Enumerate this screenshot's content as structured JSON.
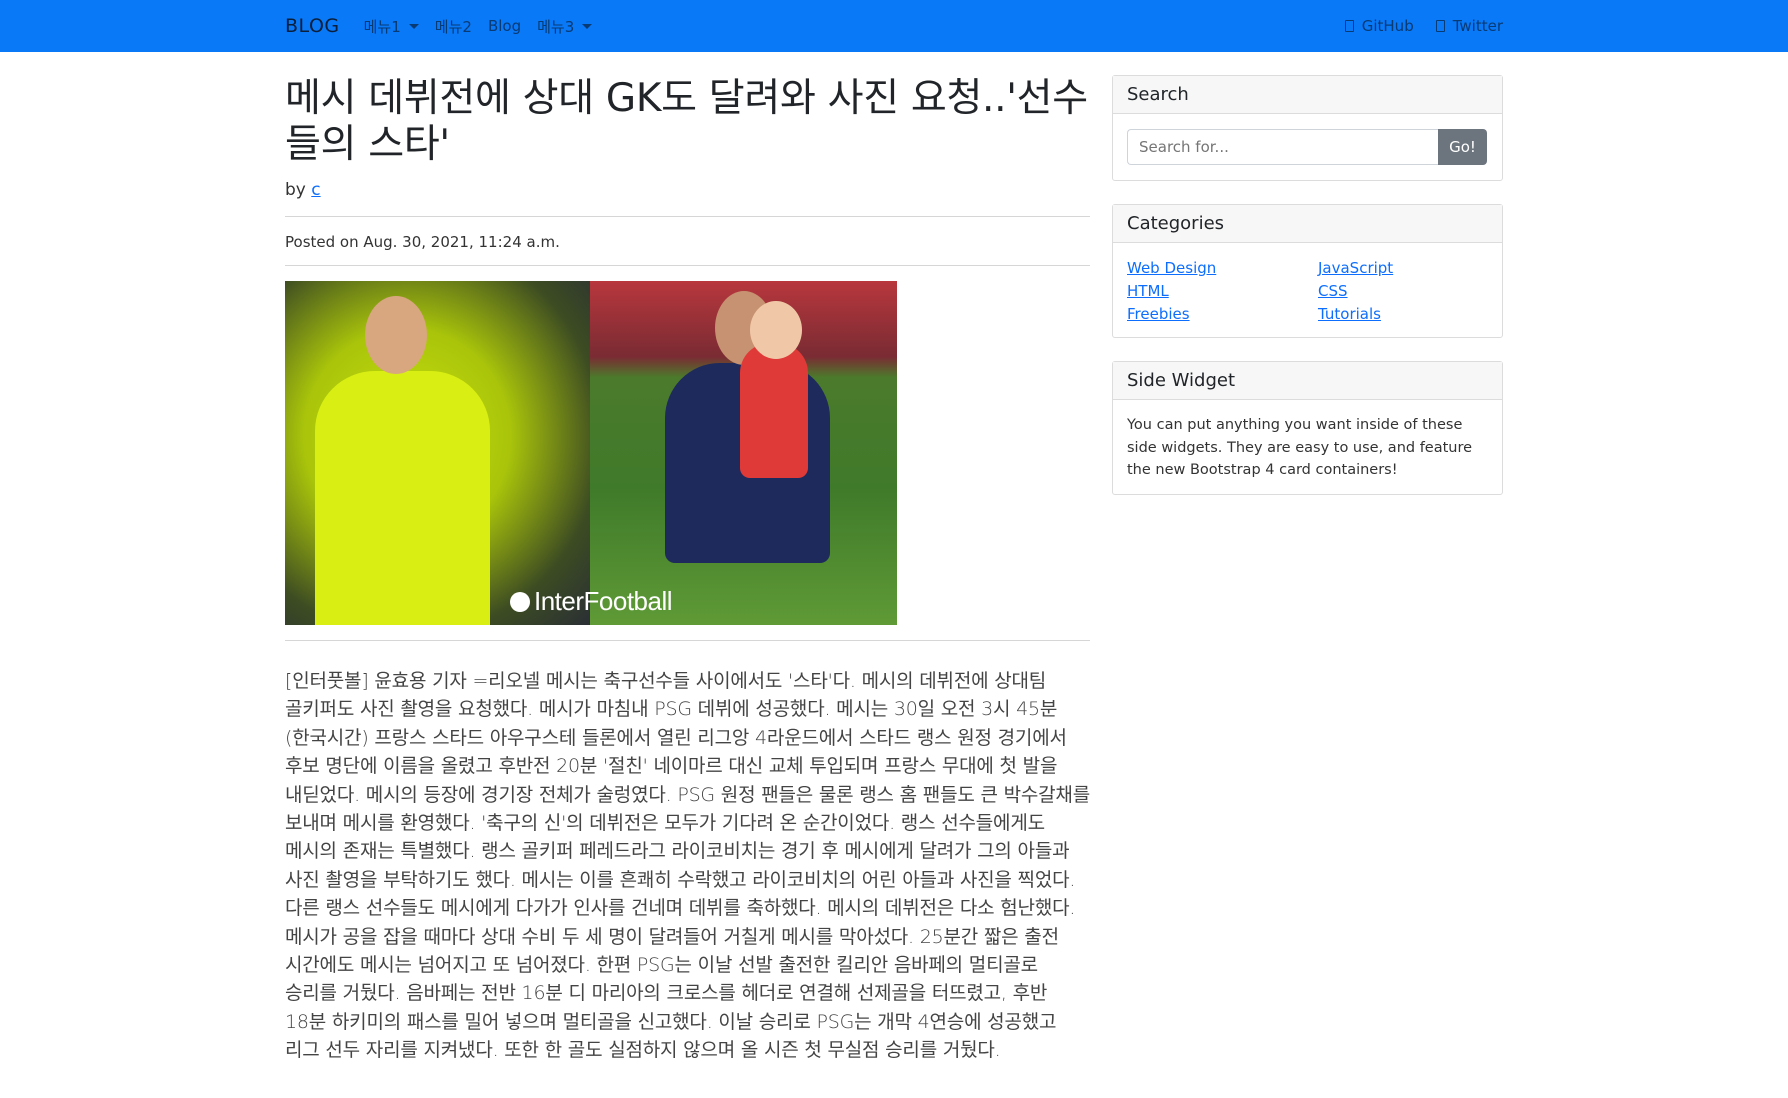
{
  "navbar": {
    "brand": "BLOG",
    "menu1": "메뉴1",
    "menu2": "메뉴2",
    "blog": "Blog",
    "menu3": "메뉴3",
    "github": "GitHub",
    "twitter": "Twitter"
  },
  "post": {
    "title": "메시 데뷔전에 상대 GK도 달려와 사진 요청..'선수들의 스타'",
    "by": "by",
    "author": "c",
    "posted": "Posted on Aug. 30, 2021, 11:24 a.m.",
    "image_watermark": "InterFootball",
    "body": "[인터풋볼] 윤효용 기자 =리오넬 메시는 축구선수들 사이에서도 '스타'다. 메시의 데뷔전에 상대팀 골키퍼도 사진 촬영을 요청했다. 메시가 마침내 PSG 데뷔에 성공했다. 메시는 30일 오전 3시 45분(한국시간) 프랑스 스타드 아우구스테 들론에서 열린 리그앙 4라운드에서 스타드 랭스 원정 경기에서 후보 명단에 이름을 올렸고 후반전 20분 '절친' 네이마르 대신 교체 투입되며 프랑스 무대에 첫 발을 내딛었다. 메시의 등장에 경기장 전체가 술렁였다. PSG 원정 팬들은 물론 랭스 홈 팬들도 큰 박수갈채를 보내며 메시를 환영했다. '축구의 신'의 데뷔전은 모두가 기다려 온 순간이었다. 랭스 선수들에게도 메시의 존재는 특별했다. 랭스 골키퍼 페레드라그 라이코비치는 경기 후 메시에게 달려가 그의 아들과 사진 촬영을 부탁하기도 했다. 메시는 이를 흔쾌히 수락했고 라이코비치의 어린 아들과 사진을 찍었다. 다른 랭스 선수들도 메시에게 다가가 인사를 건네며 데뷔를 축하했다. 메시의 데뷔전은 다소 험난했다. 메시가 공을 잡을 때마다 상대 수비 두 세 명이 달려들어 거칠게 메시를 막아섰다. 25분간 짧은 출전 시간에도 메시는 넘어지고 또 넘어졌다. 한편 PSG는 이날 선발 출전한 킬리안 음바페의 멀티골로 승리를 거뒀다. 음바페는 전반 16분 디 마리아의 크로스를 헤더로 연결해 선제골을 터뜨렸고, 후반 18분 하키미의 패스를 밀어 넣으며 멀티골을 신고했다. 이날 승리로 PSG는 개막 4연승에 성공했고 리그 선두 자리를 지켜냈다. 또한 한 골도 실점하지 않으며 올 시즌 첫 무실점 승리를 거뒀다."
  },
  "sidebar": {
    "search": {
      "header": "Search",
      "placeholder": "Search for...",
      "button": "Go!"
    },
    "categories": {
      "header": "Categories",
      "col1": [
        "Web Design",
        "HTML",
        "Freebies"
      ],
      "col2": [
        "JavaScript",
        "CSS",
        "Tutorials"
      ]
    },
    "widget": {
      "header": "Side Widget",
      "text": "You can put anything you want inside of these side widgets. They are easy to use, and feature the new Bootstrap 4 card containers!"
    }
  },
  "colors": {
    "navbar_bg": "#0a79f7",
    "link": "#0d6efd",
    "button": "#6c757d"
  }
}
